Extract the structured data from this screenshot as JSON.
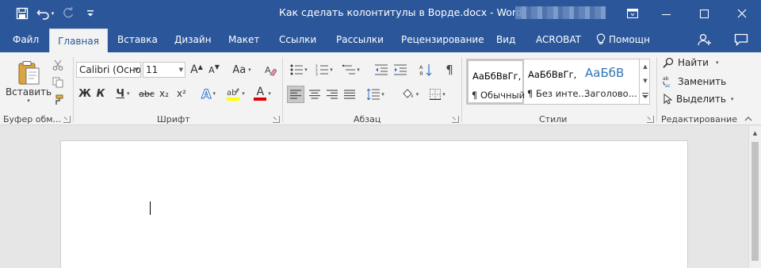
{
  "title_bar": {
    "document_title": "Как сделать колонтитулы в Ворде.docx - Word",
    "quick_access": [
      "save-icon",
      "undo-icon",
      "redo-icon",
      "customize-qat-icon"
    ],
    "window_controls": [
      "ribbon-display-icon",
      "minimize-icon",
      "maximize-icon",
      "close-icon"
    ]
  },
  "tabs": [
    {
      "label": "Файл"
    },
    {
      "label": "Главная"
    },
    {
      "label": "Вставка"
    },
    {
      "label": "Дизайн"
    },
    {
      "label": "Макет"
    },
    {
      "label": "Ссылки"
    },
    {
      "label": "Рассылки"
    },
    {
      "label": "Рецензирование"
    },
    {
      "label": "Вид"
    },
    {
      "label": "ACROBAT"
    }
  ],
  "help_label": "Помощн",
  "clipboard": {
    "paste_label": "Вставить",
    "group_label": "Буфер обм..."
  },
  "font": {
    "font_name": "Calibri (Осно",
    "font_size": "11",
    "bold": "Ж",
    "italic": "К",
    "underline": "Ч",
    "strike": "abc",
    "subscript": "x₂",
    "superscript": "x²",
    "grow": "A",
    "shrink": "A",
    "change_case": "Aa",
    "text_effects": "A",
    "font_color": "A",
    "group_label": "Шрифт"
  },
  "paragraph": {
    "group_label": "Абзац"
  },
  "styles": {
    "items": [
      {
        "sample": "АаБбВвГг,",
        "name": "¶ Обычный"
      },
      {
        "sample": "АаБбВвГг,",
        "name": "¶ Без инте..."
      },
      {
        "sample": "АаБбВ",
        "name": "Заголово..."
      }
    ],
    "group_label": "Стили"
  },
  "editing": {
    "find": "Найти",
    "replace": "Заменить",
    "select": "Выделить",
    "group_label": "Редактирование"
  },
  "colors": {
    "brand": "#2b579a",
    "ribbon_bg": "#f3f3f3",
    "highlight": "#ffff00",
    "font_color": "#e00000",
    "heading_style": "#2e74b5"
  }
}
